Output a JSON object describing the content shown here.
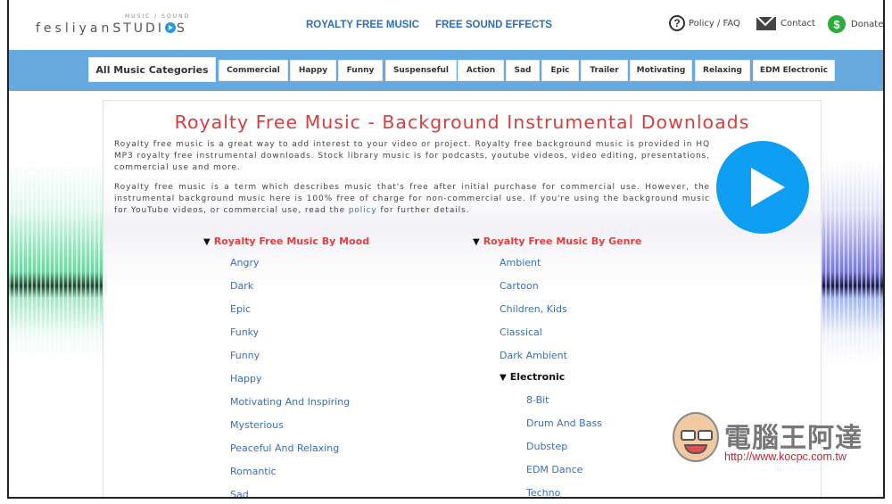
{
  "header": {
    "logo_small": "MUSIC / SOUND",
    "logo_main": "fesliyan",
    "logo_studios_a": "STUDI",
    "logo_studios_b": "S",
    "nav": [
      {
        "label": "ROYALTY FREE MUSIC"
      },
      {
        "label": "FREE SOUND EFFECTS"
      }
    ],
    "links": [
      {
        "label": "Policy / FAQ",
        "icon": "question-circle-icon"
      },
      {
        "label": "Contact",
        "icon": "envelope-icon"
      },
      {
        "label": "Donate",
        "icon": "dollar-circle-icon"
      }
    ]
  },
  "categories": [
    {
      "label": "All Music Categories"
    },
    {
      "label": "Commercial"
    },
    {
      "label": "Happy"
    },
    {
      "label": "Funny"
    },
    {
      "label": "Suspenseful"
    },
    {
      "label": "Action"
    },
    {
      "label": "Sad"
    },
    {
      "label": "Epic"
    },
    {
      "label": "Trailer"
    },
    {
      "label": "Motivating"
    },
    {
      "label": "Relaxing"
    },
    {
      "label": "EDM Electronic"
    }
  ],
  "main": {
    "title": "Royalty Free Music - Background Instrumental Downloads",
    "para1": "Royalty free music is a great way to add interest to your video or project. Royalty free background music is provided in HQ MP3 royalty free instrumental downloads. Stock library music is for podcasts, youtube videos, video editing, presentations, commercial use and more.",
    "para2_before": "Royalty free music is a term which describes music that's free after initial purchase for commercial use. However, the instrumental background music here is 100% free of charge for non-commercial use. If you're using the background music for YouTube videos, or commercial use, read the ",
    "para2_link": "policy",
    "para2_after": " for further details.",
    "mood": {
      "heading": "Royalty Free Music By Mood",
      "toggle": "▼",
      "items": [
        "Angry",
        "Dark",
        "Epic",
        "Funky",
        "Funny",
        "Happy",
        "Motivating And Inspiring",
        "Mysterious",
        "Peaceful And Relaxing",
        "Romantic",
        "Sad"
      ]
    },
    "genre": {
      "heading": "Royalty Free Music By Genre",
      "toggle": "▼",
      "items": [
        "Ambient",
        "Cartoon",
        "Children, Kids",
        "Classical",
        "Dark Ambient"
      ],
      "sub": {
        "heading": "Electronic",
        "toggle": "▼",
        "items": [
          "8-Bit",
          "Drum And Bass",
          "Dubstep",
          "EDM Dance",
          "Techno"
        ]
      }
    }
  },
  "watermark": {
    "text": "電腦王阿達",
    "url": "http://www.kocpc.com.tw"
  }
}
